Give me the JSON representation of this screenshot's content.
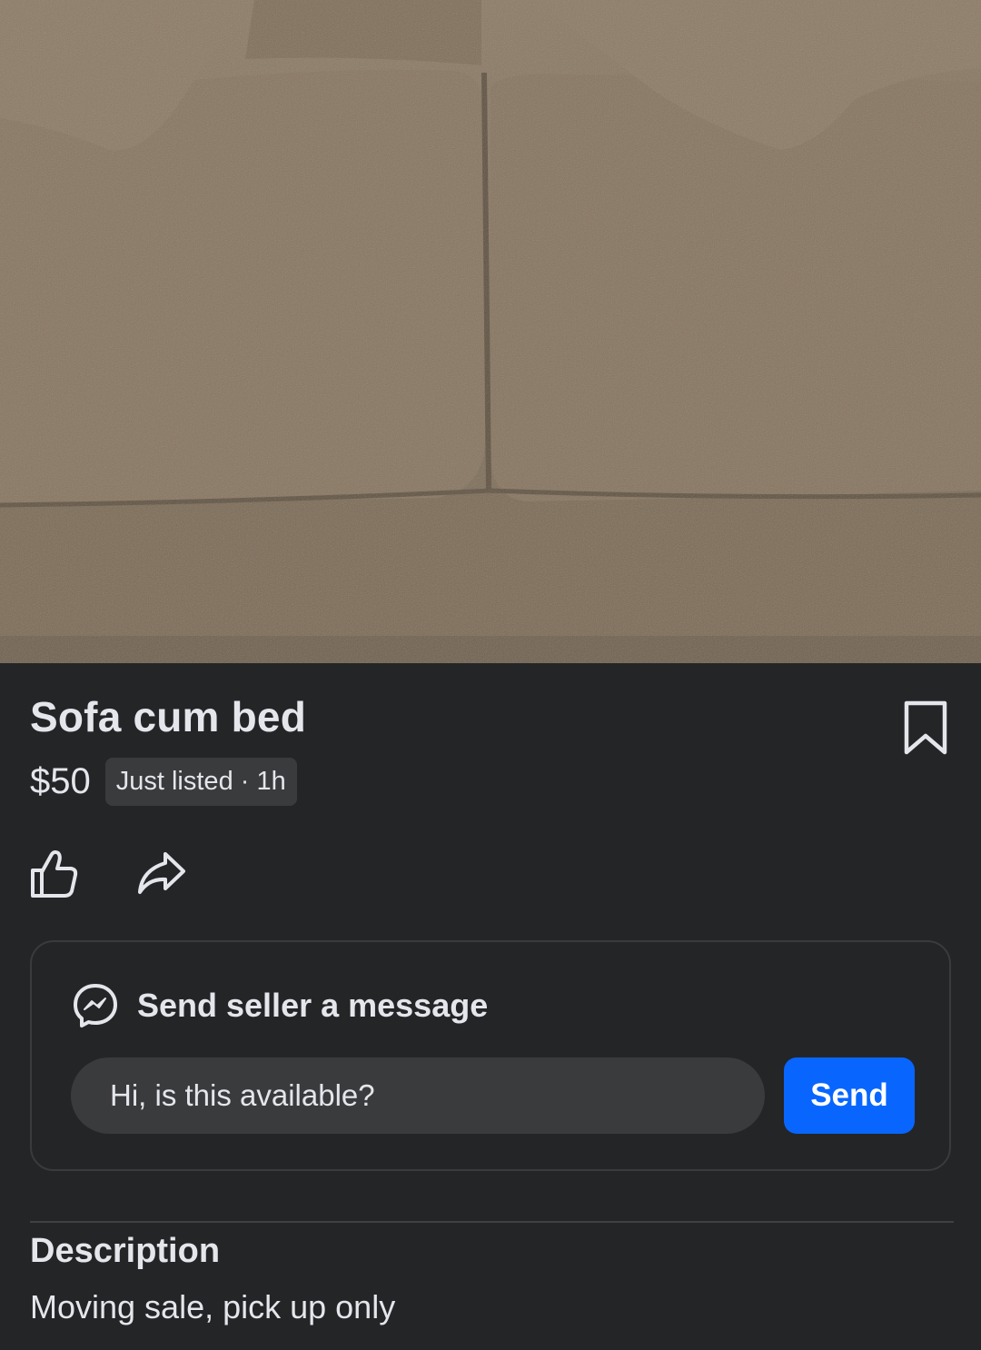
{
  "listing": {
    "photo_alt": "Sofa cum bed",
    "title": "Sofa cum bed",
    "price": "$50",
    "listed_badge": "Just listed · 1h"
  },
  "actions": {
    "like_icon": "thumbs-up-icon",
    "share_icon": "share-icon",
    "save_icon": "bookmark-icon"
  },
  "message": {
    "heading": "Send seller a message",
    "icon": "messenger-icon",
    "input_value": "Hi, is this available?",
    "send_label": "Send"
  },
  "description": {
    "heading": "Description",
    "text": "Moving sale, pick up only"
  },
  "colors": {
    "background": "#242527",
    "accent": "#0866ff",
    "input_bg": "#3a3b3c"
  }
}
